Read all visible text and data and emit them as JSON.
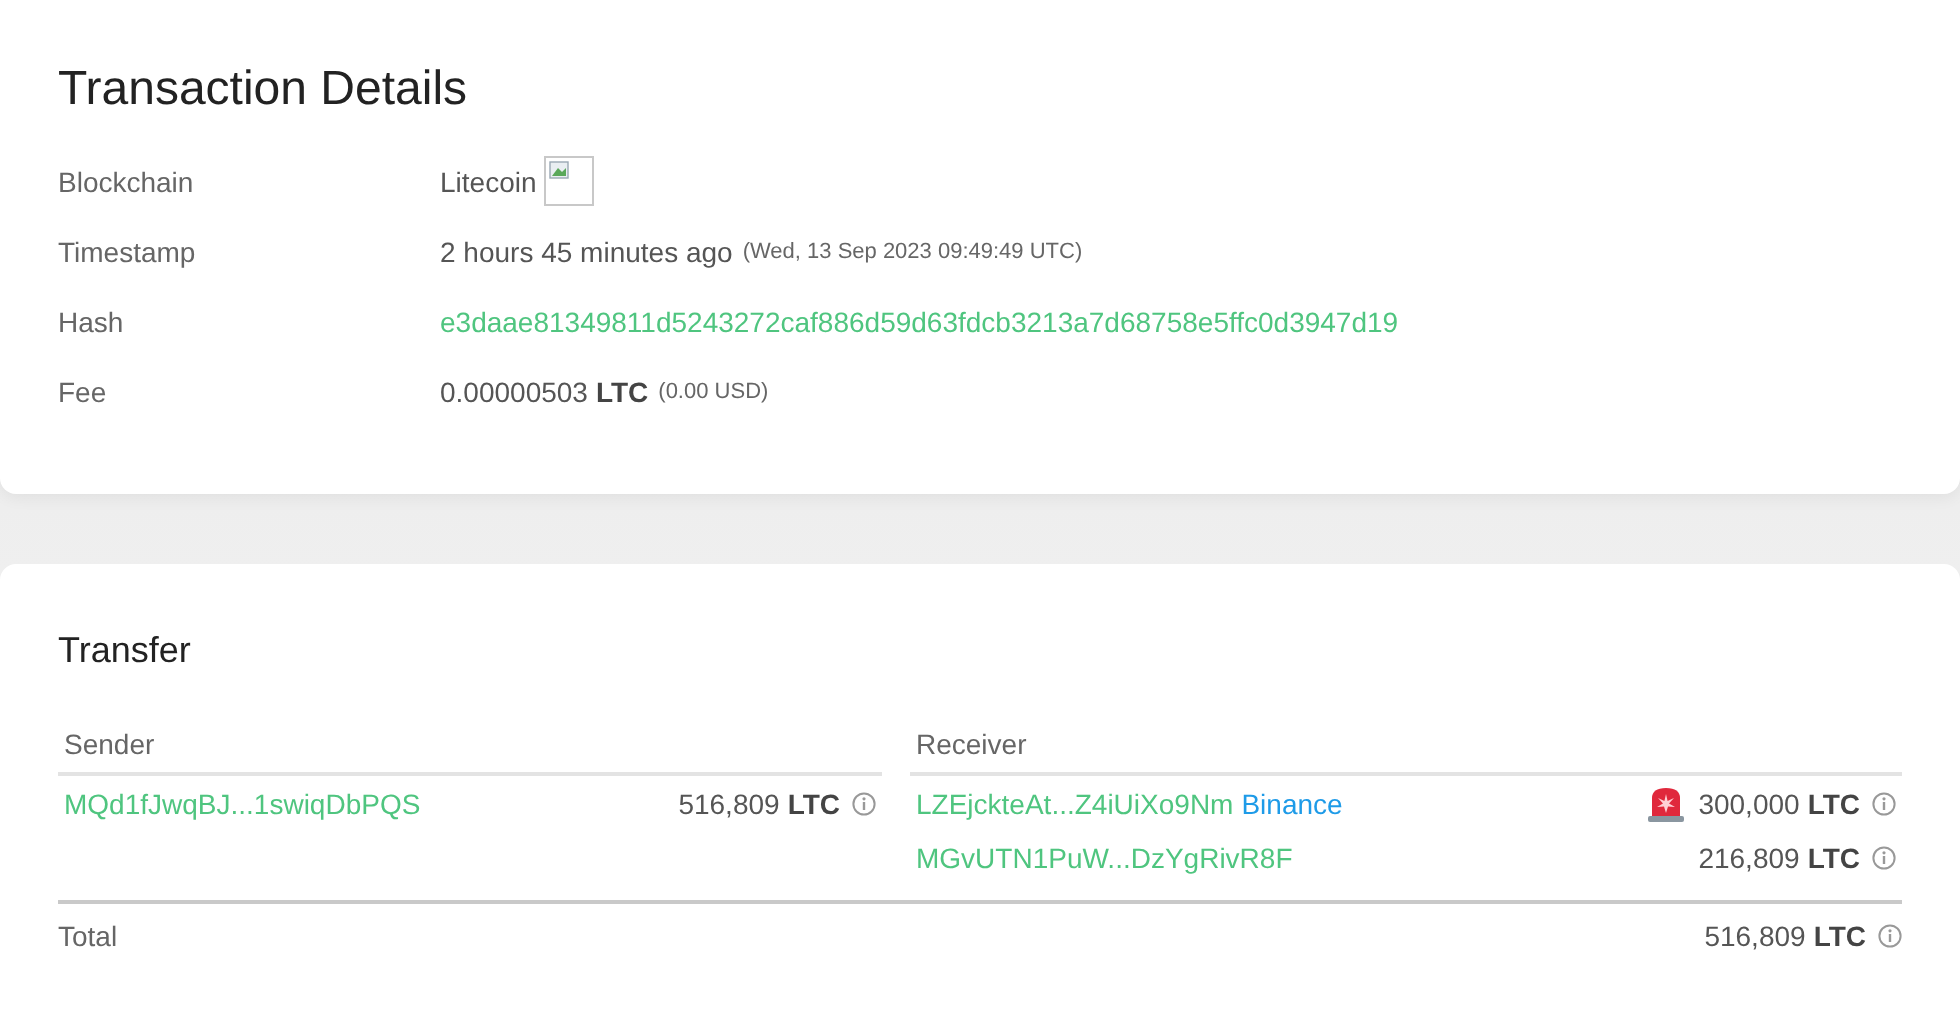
{
  "details": {
    "title": "Transaction Details",
    "rows": [
      {
        "label": "Blockchain",
        "kind": "chain",
        "value": "Litecoin"
      },
      {
        "label": "Timestamp",
        "kind": "time",
        "value": "2 hours 45 minutes ago",
        "note": "(Wed, 13 Sep 2023 09:49:49 UTC)"
      },
      {
        "label": "Hash",
        "kind": "link",
        "value": "e3daae81349811d5243272caf886d59d63fdcb3213a7d68758e5ffc0d3947d19"
      },
      {
        "label": "Fee",
        "kind": "amount",
        "value": "0.00000503",
        "unit": "LTC",
        "note": "(0.00 USD)"
      }
    ]
  },
  "transfer": {
    "title": "Transfer",
    "sender": {
      "heading": "Sender",
      "rows": [
        {
          "address": "MQd1fJwqBJ...1swiqDbPQS",
          "alert": false,
          "amount": "516,809",
          "unit": "LTC"
        }
      ]
    },
    "receiver": {
      "heading": "Receiver",
      "rows": [
        {
          "address": "LZEjckteAt...Z4iUiXo9Nm",
          "tag": "Binance",
          "alert": true,
          "amount": "300,000",
          "unit": "LTC"
        },
        {
          "address": "MGvUTN1PuW...DzYgRivR8F",
          "alert": false,
          "amount": "216,809",
          "unit": "LTC"
        }
      ]
    },
    "total": {
      "label": "Total",
      "amount": "516,809",
      "unit": "LTC"
    }
  }
}
